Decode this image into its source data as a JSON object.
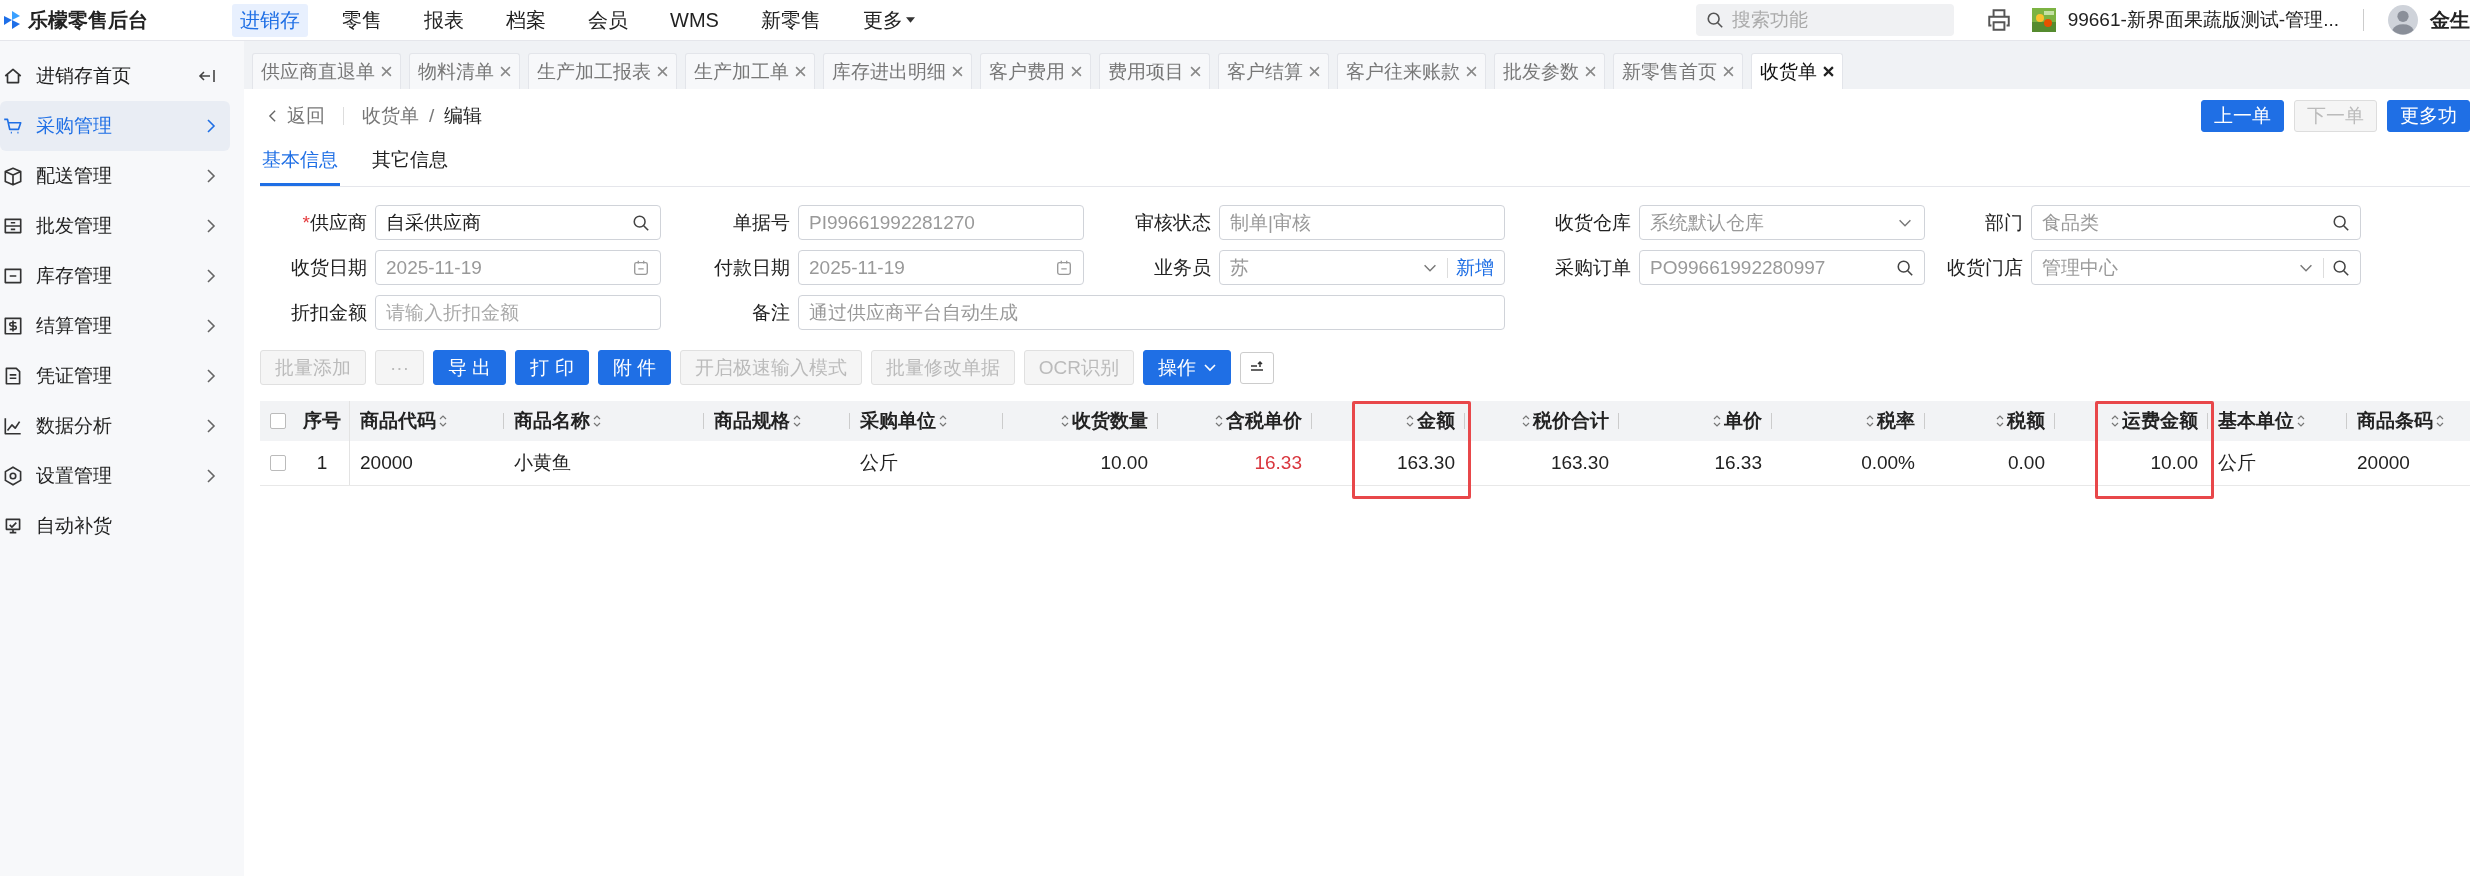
{
  "app": {
    "title": "乐檬零售后台"
  },
  "top_nav": [
    {
      "label": "进销存",
      "selected": true,
      "dropdown": false
    },
    {
      "label": "零售",
      "selected": false,
      "dropdown": false
    },
    {
      "label": "报表",
      "selected": false,
      "dropdown": false
    },
    {
      "label": "档案",
      "selected": false,
      "dropdown": false
    },
    {
      "label": "会员",
      "selected": false,
      "dropdown": false
    },
    {
      "label": "WMS",
      "selected": false,
      "dropdown": false
    },
    {
      "label": "新零售",
      "selected": false,
      "dropdown": false
    },
    {
      "label": "更多",
      "selected": false,
      "dropdown": true
    }
  ],
  "search": {
    "placeholder": "搜索功能"
  },
  "store": {
    "name": "99661-新界面果蔬版测试-管理..."
  },
  "user": {
    "name": "金生"
  },
  "sidebar": [
    {
      "label": "进销存首页",
      "selected": false,
      "has_children": false,
      "collapse_toggle": true
    },
    {
      "label": "采购管理",
      "selected": true,
      "has_children": true,
      "collapse_toggle": false
    },
    {
      "label": "配送管理",
      "selected": false,
      "has_children": true,
      "collapse_toggle": false
    },
    {
      "label": "批发管理",
      "selected": false,
      "has_children": true,
      "collapse_toggle": false
    },
    {
      "label": "库存管理",
      "selected": false,
      "has_children": true,
      "collapse_toggle": false
    },
    {
      "label": "结算管理",
      "selected": false,
      "has_children": true,
      "collapse_toggle": false
    },
    {
      "label": "凭证管理",
      "selected": false,
      "has_children": true,
      "collapse_toggle": false
    },
    {
      "label": "数据分析",
      "selected": false,
      "has_children": true,
      "collapse_toggle": false
    },
    {
      "label": "设置管理",
      "selected": false,
      "has_children": true,
      "collapse_toggle": false
    },
    {
      "label": "自动补货",
      "selected": false,
      "has_children": false,
      "collapse_toggle": false
    }
  ],
  "tabs": [
    {
      "label": "供应商直退单",
      "selected": false
    },
    {
      "label": "物料清单",
      "selected": false
    },
    {
      "label": "生产加工报表",
      "selected": false
    },
    {
      "label": "生产加工单",
      "selected": false
    },
    {
      "label": "库存进出明细",
      "selected": false
    },
    {
      "label": "客户费用",
      "selected": false
    },
    {
      "label": "费用项目",
      "selected": false
    },
    {
      "label": "客户结算",
      "selected": false
    },
    {
      "label": "客户往来账款",
      "selected": false
    },
    {
      "label": "批发参数",
      "selected": false
    },
    {
      "label": "新零售首页",
      "selected": false
    },
    {
      "label": "收货单",
      "selected": true
    }
  ],
  "breadcrumb": {
    "back": "返回",
    "parent": "收货单",
    "separator": "/",
    "current": "编辑"
  },
  "page_actions": [
    {
      "label": "上一单",
      "disabled": false
    },
    {
      "label": "下一单",
      "disabled": true
    },
    {
      "label": "更多功",
      "disabled": false
    }
  ],
  "sub_tabs": [
    {
      "label": "基本信息",
      "selected": true
    },
    {
      "label": "其它信息",
      "selected": false
    }
  ],
  "form": [
    {
      "label": "供应商",
      "required_mark": "*",
      "value": "自采供应商",
      "disabled": false,
      "kind": "search",
      "wide": false
    },
    {
      "label": "单据号",
      "value": "PI99661992281270",
      "disabled": true,
      "kind": "text",
      "wide": false
    },
    {
      "label": "审核状态",
      "value": "制单|审核",
      "disabled": true,
      "kind": "text",
      "wide": false
    },
    {
      "label": "收货仓库",
      "value": "系统默认仓库",
      "disabled": true,
      "kind": "select",
      "wide": false
    },
    {
      "label": "部门",
      "value": "食品类",
      "disabled": true,
      "kind": "search",
      "wide": false
    },
    {
      "label": "收货日期",
      "value": "2025-11-19",
      "disabled": true,
      "kind": "date",
      "wide": false
    },
    {
      "label": "付款日期",
      "value": "2025-11-19",
      "disabled": true,
      "kind": "date",
      "wide": false
    },
    {
      "label": "业务员",
      "value": "苏",
      "disabled": true,
      "kind": "select",
      "wide": false,
      "link": "新增"
    },
    {
      "label": "采购订单",
      "value": "PO99661992280997",
      "disabled": true,
      "kind": "search",
      "wide": false
    },
    {
      "label": "收货门店",
      "value": "管理中心",
      "disabled": true,
      "kind": "select-search",
      "wide": false
    },
    {
      "label": "折扣金额",
      "placeholder": "请输入折扣金额",
      "kind": "text",
      "wide": false
    },
    {
      "label": "备注",
      "value": "通过供应商平台自动生成",
      "disabled": true,
      "kind": "text",
      "wide": true
    }
  ],
  "toolbar": [
    {
      "label": "批量添加",
      "kind": "default",
      "disabled": true
    },
    {
      "label": "···",
      "kind": "default",
      "disabled": true
    },
    {
      "label": "导 出",
      "kind": "primary",
      "disabled": false
    },
    {
      "label": "打 印",
      "kind": "primary",
      "disabled": false
    },
    {
      "label": "附 件",
      "kind": "primary",
      "disabled": false
    },
    {
      "label": "开启极速输入模式",
      "kind": "default",
      "disabled": true
    },
    {
      "label": "批量修改单据",
      "kind": "default",
      "disabled": true
    },
    {
      "label": "OCR识别",
      "kind": "default",
      "disabled": true
    },
    {
      "label": "操作",
      "kind": "dropdown",
      "disabled": false
    },
    {
      "kind": "icon"
    }
  ],
  "table": {
    "select_all": {
      "checked": false
    },
    "columns": [
      {
        "label": "序号",
        "kind": "index",
        "sortable": false,
        "highlighted": false
      },
      {
        "label": "商品代码",
        "kind": "text",
        "sortable": true,
        "highlighted": false
      },
      {
        "label": "商品名称",
        "kind": "text",
        "sortable": true,
        "highlighted": false
      },
      {
        "label": "商品规格",
        "kind": "text",
        "sortable": true,
        "highlighted": false
      },
      {
        "label": "采购单位",
        "kind": "text",
        "sortable": true,
        "highlighted": false
      },
      {
        "label": "收货数量",
        "kind": "number",
        "sortable": true,
        "highlighted": false
      },
      {
        "label": "含税单价",
        "kind": "number",
        "sortable": true,
        "highlighted": false,
        "emphasis": true
      },
      {
        "label": "金额",
        "kind": "number",
        "sortable": true,
        "highlighted": true
      },
      {
        "label": "税价合计",
        "kind": "number",
        "sortable": true,
        "highlighted": false
      },
      {
        "label": "单价",
        "kind": "number",
        "sortable": true,
        "highlighted": false
      },
      {
        "label": "税率",
        "kind": "number",
        "sortable": true,
        "highlighted": false
      },
      {
        "label": "税额",
        "kind": "number",
        "sortable": true,
        "highlighted": false
      },
      {
        "label": "运费金额",
        "kind": "number",
        "sortable": true,
        "highlighted": true
      },
      {
        "label": "基本单位",
        "kind": "text",
        "sortable": true,
        "highlighted": false
      },
      {
        "label": "商品条码",
        "kind": "text",
        "sortable": true,
        "highlighted": false
      }
    ],
    "rows": [
      {
        "checked": false,
        "cells": [
          "1",
          "20000",
          "小黄鱼",
          "",
          "公斤",
          "10.00",
          "16.33",
          "163.30",
          "163.30",
          "16.33",
          "0.00%",
          "0.00",
          "10.00",
          "公斤",
          "20000"
        ]
      }
    ]
  }
}
